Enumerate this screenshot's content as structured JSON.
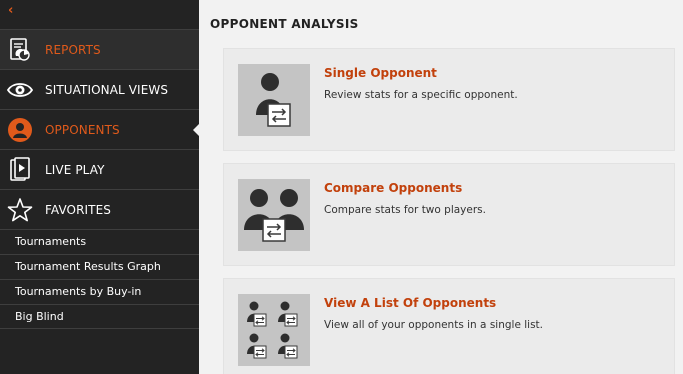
{
  "colors": {
    "accent": "#e05a1b",
    "sidebar_bg": "#232323",
    "main_bg": "#f2f2f2",
    "card_title": "#c2410c"
  },
  "sidebar": {
    "back_icon": "chevron-left-icon",
    "nav": [
      {
        "label": "REPORTS",
        "icon": "reports-icon",
        "active": true
      },
      {
        "label": "SITUATIONAL VIEWS",
        "icon": "eye-icon",
        "active": false
      },
      {
        "label": "OPPONENTS",
        "icon": "person-circle-icon",
        "active": true
      },
      {
        "label": "LIVE PLAY",
        "icon": "live-play-icon",
        "active": false
      },
      {
        "label": "FAVORITES",
        "icon": "star-icon",
        "active": false
      }
    ],
    "favorites": [
      "Tournaments",
      "Tournament Results Graph",
      "Tournaments by Buy-in",
      "Big Blind"
    ]
  },
  "main": {
    "title": "OPPONENT ANALYSIS",
    "cards": [
      {
        "title": "Single Opponent",
        "desc": "Review stats for a specific opponent.",
        "icon": "single-opponent-icon"
      },
      {
        "title": "Compare Opponents",
        "desc": "Compare stats for two players.",
        "icon": "compare-opponents-icon"
      },
      {
        "title": "View A List Of Opponents",
        "desc": "View all of your opponents in a single list.",
        "icon": "opponents-list-icon"
      }
    ]
  }
}
